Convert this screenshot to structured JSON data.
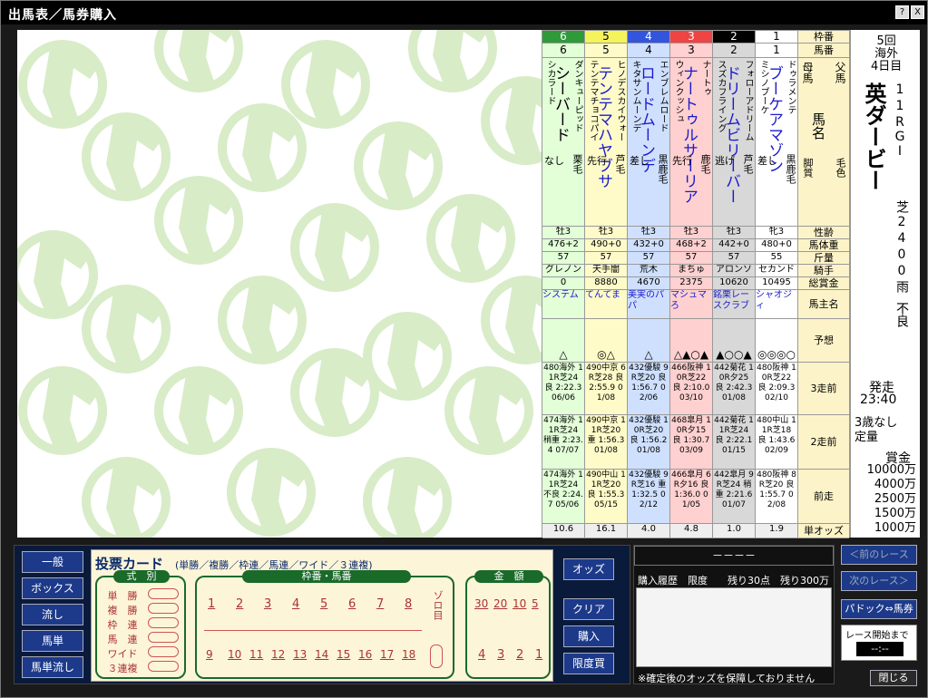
{
  "window": {
    "title": "出馬表／馬券購入",
    "help_btn": "?",
    "close_btn": "X"
  },
  "race": {
    "round": "5回",
    "venue": "海外",
    "day": "4日目",
    "name": "英ダービー",
    "race_no": "11R",
    "grade": "GⅠ",
    "course": "芝2400",
    "weather": "雨",
    "track": "不良",
    "start_label": "発走",
    "start_time": "23:40",
    "condition1": "3歳なし",
    "condition2": "定量",
    "prize_label": "賞金",
    "prizes": [
      "10000万",
      "4000万",
      "2500万",
      "1500万",
      "1000万"
    ]
  },
  "row_labels": {
    "waku": "枠番",
    "umaban": "馬番",
    "father": "父馬",
    "mother": "母馬",
    "horse": "馬名",
    "style": "脚質",
    "coat": "毛色",
    "sexage": "性齢",
    "weight": "馬体重",
    "kinryo": "斤量",
    "jockey": "騎手",
    "prize": "総賞金",
    "owner": "馬主名",
    "yoso": "予想",
    "prev3": "3走前",
    "prev2": "2走前",
    "prev1": "前走",
    "odds": "単オッズ"
  },
  "horses": [
    {
      "waku": "1",
      "umaban": "1",
      "father": "ドゥラメンテ",
      "name": "ブーケアマゾン",
      "mother": "ミシノブーケ",
      "style": "差し",
      "coat": "黒鹿毛",
      "sexage": "牝3",
      "weight": "480+0",
      "kinryo": "55",
      "jockey": "セカンド",
      "prize": "10495",
      "owner": "シャオジィ",
      "yoso": "◎◎◎○",
      "p3": "480阪神 10R芝22 良 2:09.3 02/10",
      "p2": "480中山 11R芝18 良 1:43.6 02/09",
      "p1": "480阪神 8R芝20 良 1:55.7 02/08",
      "odds": "1.9",
      "color": "#ffffff",
      "fg": "#000",
      "namecolor": "#1a1acc",
      "bg": "#fff"
    },
    {
      "waku": "2",
      "umaban": "2",
      "father": "フォローアドリーム",
      "name": "ドリームビリーバー",
      "mother": "スズカフライング",
      "style": "逃げ",
      "coat": "芦毛",
      "sexage": "牡3",
      "weight": "442+0",
      "kinryo": "57",
      "jockey": "アロンソ",
      "prize": "10620",
      "owner": "銘栗レースクラブ",
      "yoso": "▲○○▲",
      "p3": "442菊花 10R夕25 良 2:42.3 01/08",
      "p2": "442菊花 11R芝24 良 2:22.1 01/15",
      "p1": "442皐月 9R芝24 稍重 2:21.6 01/07",
      "odds": "1.0",
      "color": "#000",
      "fg": "#fff",
      "namecolor": "#1a1acc",
      "bg": "#d8d8d8"
    },
    {
      "waku": "3",
      "umaban": "3",
      "father": "ナートゥ",
      "name": "ナートゥルサーリア",
      "mother": "ウィンクッシュ",
      "style": "先行",
      "coat": "鹿毛",
      "sexage": "牡3",
      "weight": "468+2",
      "kinryo": "57",
      "jockey": "まちゅ",
      "prize": "2375",
      "owner": "マシュマろ",
      "yoso": "△▲○▲",
      "p3": "466阪神 10R芝22 良 2:10.0 03/10",
      "p2": "468皐月 10R夕15 良 1:30.7 03/09",
      "p1": "466皐月 6R夕16 良 1:36.0 01/05",
      "odds": "4.8",
      "color": "#ee4444",
      "fg": "#fff",
      "namecolor": "#1a1acc",
      "bg": "#ffd0d0"
    },
    {
      "waku": "4",
      "umaban": "4",
      "father": "エンブレムロード",
      "name": "ロードムーンデ",
      "mother": "キタサンムーンデ",
      "style": "差し",
      "coat": "黒鹿毛",
      "sexage": "牡3",
      "weight": "432+0",
      "kinryo": "57",
      "jockey": "荒木",
      "prize": "4670",
      "owner": "美実のパパ",
      "yoso": "△",
      "p3": "432優駿 9R芝20 良 1:56.7 02/06",
      "p2": "432優駿 10R芝20 良 1:56.2 01/08",
      "p1": "432優駿 9R芝16 重 1:32.5 02/12",
      "odds": "4.0",
      "color": "#3355dd",
      "fg": "#fff",
      "namecolor": "#1a1acc",
      "bg": "#cfe0ff"
    },
    {
      "waku": "5",
      "umaban": "5",
      "father": "ヒノデスカイウォー",
      "name": "テンテマハヤブサ",
      "mother": "テンテマチョコパイ",
      "style": "先行",
      "coat": "芦毛",
      "sexage": "牡3",
      "weight": "490+0",
      "kinryo": "57",
      "jockey": "天手闇",
      "prize": "8880",
      "owner": "てんてま",
      "yoso": "◎△",
      "p3": "490中京 6R芝28 良 2:55.9 01/08",
      "p2": "490中京 11R芝20 重 1:56.3 01/08",
      "p1": "490中山 11R芝20 良 1:55.3 05/15",
      "odds": "16.1",
      "color": "#f4f45a",
      "fg": "#000",
      "namecolor": "#1a1acc",
      "bg": "#fffbc8"
    },
    {
      "waku": "6",
      "umaban": "6",
      "father": "ダンキューピッド",
      "name": "シーバード",
      "mother": "シカラード",
      "style": "なし",
      "coat": "栗毛",
      "sexage": "牡3",
      "weight": "476+2",
      "kinryo": "57",
      "jockey": "グレノン",
      "prize": "0",
      "owner": "システム",
      "yoso": "△",
      "p3": "480海外 11R芝24 良 2:22.3 06/06",
      "p2": "474海外 11R芝24 稍重 2:23.4 07/07",
      "p1": "474海外 11R芝24 不良 2:24.7 05/06",
      "odds": "10.6",
      "color": "#2f9a3a",
      "fg": "#fff",
      "namecolor": "#000",
      "bg": "#e2ffd8"
    }
  ],
  "nav": {
    "ippan": "一般",
    "box": "ボックス",
    "nagashi": "流し",
    "umatan": "馬単",
    "umatan_nagashi": "馬単流し"
  },
  "card": {
    "title": "投票カード",
    "subtitle": "(単勝／複勝／枠連／馬連／ワイド／３連複)",
    "shiki_label": "式　別",
    "types": [
      "単　勝",
      "複　勝",
      "枠　連",
      "馬　連",
      "ワイド",
      "３連複"
    ],
    "waku_label": "枠番・馬番",
    "nums_top": [
      "1",
      "2",
      "3",
      "4",
      "5",
      "6",
      "7",
      "8"
    ],
    "nums_bottom": [
      "9",
      "10",
      "11",
      "12",
      "13",
      "14",
      "15",
      "16",
      "17",
      "18"
    ],
    "zorome": "ゾロ目",
    "kingaku_label": "金　額",
    "amount_top": [
      "30",
      "20",
      "10",
      "5"
    ],
    "amount_bottom": [
      "4",
      "3",
      "2",
      "1"
    ]
  },
  "actions": {
    "odds": "オッズ",
    "clear": "クリア",
    "buy": "購入",
    "limit": "限度買"
  },
  "history": {
    "dashes": "－－－－",
    "header": "購入履歴　限度　　残り30点　残り300万",
    "note": "※確定後のオッズを保障しておりません"
  },
  "right": {
    "prev": "＜前のレース",
    "next": "次のレース＞",
    "paddock": "パドック⇔馬券",
    "until_label": "レース開始まで",
    "until_value": "--:--",
    "close": "閉じる"
  }
}
